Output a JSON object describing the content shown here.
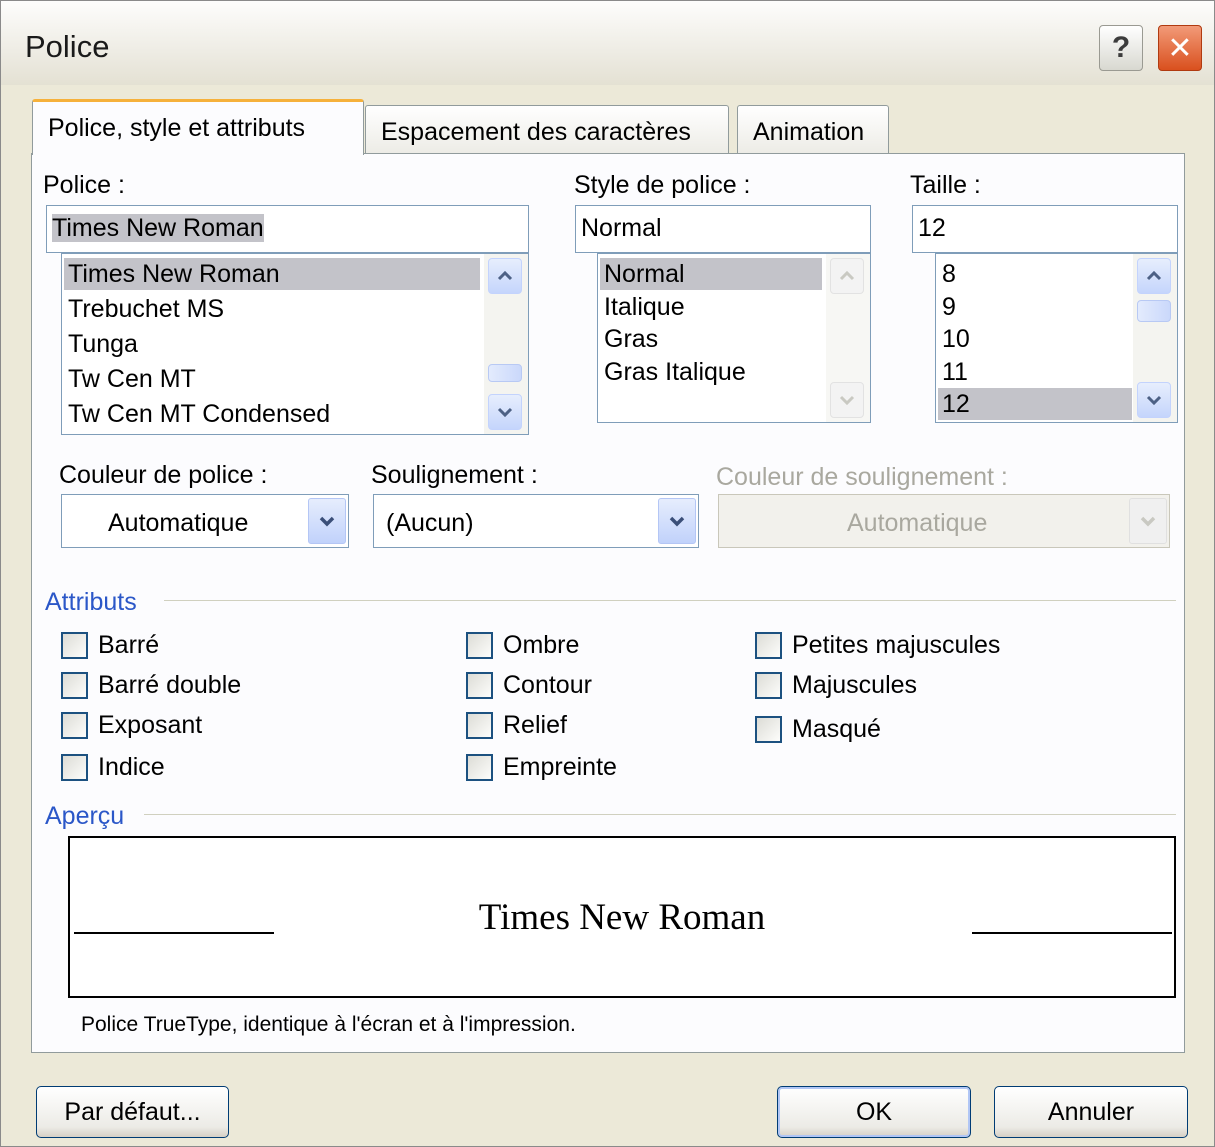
{
  "title": "Police",
  "title_buttons": {
    "help": "?",
    "close": "✕"
  },
  "tabs": [
    {
      "label": "Police, style et attributs",
      "active": true
    },
    {
      "label": "Espacement des caractères",
      "active": false
    },
    {
      "label": "Animation",
      "active": false
    }
  ],
  "font": {
    "label": "Police :",
    "value": "Times New Roman",
    "items": [
      "Times New Roman",
      "Trebuchet MS",
      "Tunga",
      "Tw Cen MT",
      "Tw Cen MT Condensed"
    ],
    "selected": "Times New Roman"
  },
  "style": {
    "label": "Style de police :",
    "value": "Normal",
    "items": [
      "Normal",
      "Italique",
      "Gras",
      "Gras Italique"
    ],
    "selected": "Normal"
  },
  "size": {
    "label": "Taille :",
    "value": "12",
    "items": [
      "8",
      "9",
      "10",
      "11",
      "12"
    ],
    "selected": "12"
  },
  "font_color": {
    "label": "Couleur de police :",
    "value": "Automatique"
  },
  "underline": {
    "label": "Soulignement :",
    "value": "(Aucun)"
  },
  "underline_color": {
    "label": "Couleur de soulignement :",
    "value": "Automatique",
    "enabled": false
  },
  "attributes": {
    "title": "Attributs",
    "items": [
      {
        "label": "Barré",
        "checked": false
      },
      {
        "label": "Barré double",
        "checked": false
      },
      {
        "label": "Exposant",
        "checked": false
      },
      {
        "label": "Indice",
        "checked": false
      },
      {
        "label": "Ombre",
        "checked": false
      },
      {
        "label": "Contour",
        "checked": false
      },
      {
        "label": "Relief",
        "checked": false
      },
      {
        "label": "Empreinte",
        "checked": false
      },
      {
        "label": "Petites majuscules",
        "checked": false
      },
      {
        "label": "Majuscules",
        "checked": false
      },
      {
        "label": "Masqué",
        "checked": false
      }
    ]
  },
  "preview": {
    "title": "Aperçu",
    "text": "Times New Roman",
    "note": "Police TrueType, identique à l'écran et à l'impression."
  },
  "buttons": {
    "default": "Par défaut...",
    "ok": "OK",
    "cancel": "Annuler"
  },
  "colors": {
    "selection": "#c3c3c9",
    "group_title": "#2b57c8",
    "active_tab_accent": "#f6b13b"
  }
}
